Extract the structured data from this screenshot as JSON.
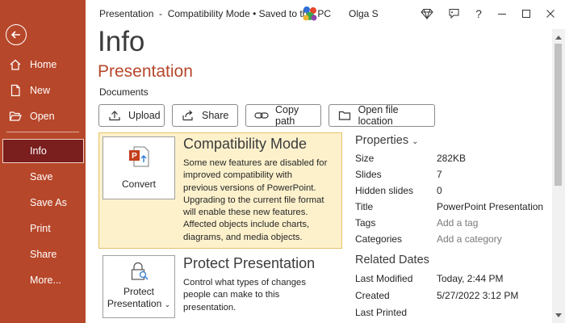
{
  "sidebar": {
    "back": "back",
    "items": [
      {
        "label": "Home"
      },
      {
        "label": "New"
      },
      {
        "label": "Open"
      },
      {
        "label": "Info"
      },
      {
        "label": "Save"
      },
      {
        "label": "Save As"
      },
      {
        "label": "Print"
      },
      {
        "label": "Share"
      },
      {
        "label": "More..."
      }
    ]
  },
  "titlebar": {
    "doc_title": "Presentation  -  Compatibility Mode • Saved to this PC",
    "user": "Olga S"
  },
  "main": {
    "heading": "Info",
    "doc_name": "Presentation",
    "location": "Documents",
    "actions": {
      "upload": "Upload",
      "share": "Share",
      "copy_path": "Copy path",
      "open_location": "Open file location"
    },
    "compat": {
      "button": "Convert",
      "title": "Compatibility Mode",
      "lines": [
        "Some new features are disabled for",
        "improved compatibility with",
        "previous versions of PowerPoint.",
        "Upgrading to the current file format",
        "will enable these new features.",
        "Affected objects include charts,",
        "diagrams, and media objects."
      ]
    },
    "protect": {
      "button_line1": "Protect",
      "button_line2": "Presentation",
      "title": "Protect Presentation",
      "lines": [
        "Control what types of changes",
        "people can make to this",
        "presentation."
      ]
    }
  },
  "properties": {
    "heading": "Properties",
    "rows": [
      {
        "key": "Size",
        "value": "282KB"
      },
      {
        "key": "Slides",
        "value": "7"
      },
      {
        "key": "Hidden slides",
        "value": "0"
      },
      {
        "key": "Title",
        "value": "PowerPoint Presentation"
      },
      {
        "key": "Tags",
        "value": "Add a tag"
      },
      {
        "key": "Categories",
        "value": "Add a category"
      }
    ]
  },
  "dates": {
    "heading": "Related Dates",
    "rows": [
      {
        "key": "Last Modified",
        "value": "Today, 2:44 PM"
      },
      {
        "key": "Created",
        "value": "5/27/2022 3:12 PM"
      },
      {
        "key": "Last Printed",
        "value": ""
      }
    ]
  },
  "colors": {
    "sidebar": "#b7472a",
    "sidebar_active": "#7a1e1e",
    "compat_bg": "#fdf1cc",
    "accent_text": "#b7472a"
  }
}
